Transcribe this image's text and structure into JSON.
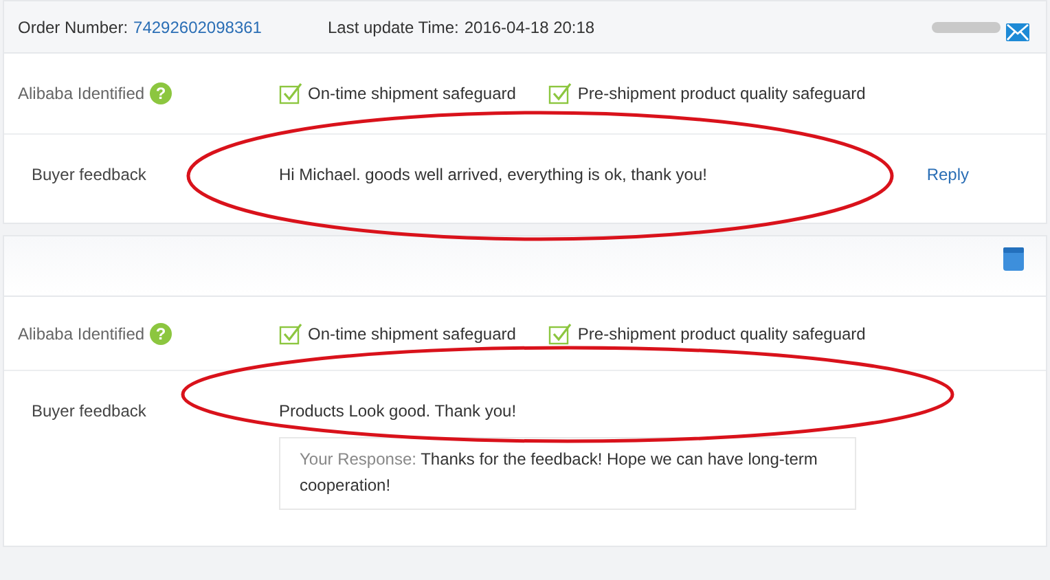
{
  "orders": [
    {
      "header": {
        "order_label": "Order Number:",
        "order_number": "74292602098361",
        "update_label": "Last update Time:",
        "update_time": "2016-04-18 20:18",
        "redacted_name": true
      },
      "identified": {
        "label": "Alibaba Identified",
        "help_glyph": "?",
        "safeguards": [
          "On-time shipment safeguard",
          "Pre-shipment product quality safeguard"
        ]
      },
      "feedback": {
        "label": "Buyer feedback",
        "text": "Hi Michael. goods well arrived, everything is ok, thank you!",
        "reply_link": "Reply",
        "highlighted": true
      }
    },
    {
      "header": {
        "redacted_name": false
      },
      "identified": {
        "label": "Alibaba Identified",
        "help_glyph": "?",
        "safeguards": [
          "On-time shipment safeguard",
          "Pre-shipment product quality safeguard"
        ]
      },
      "feedback": {
        "label": "Buyer feedback",
        "text": "Products Look good. Thank you!",
        "response_label": "Your Response:",
        "response_text": "Thanks for the feedback! Hope we can have long-term cooperation!",
        "highlighted": true
      }
    }
  ]
}
